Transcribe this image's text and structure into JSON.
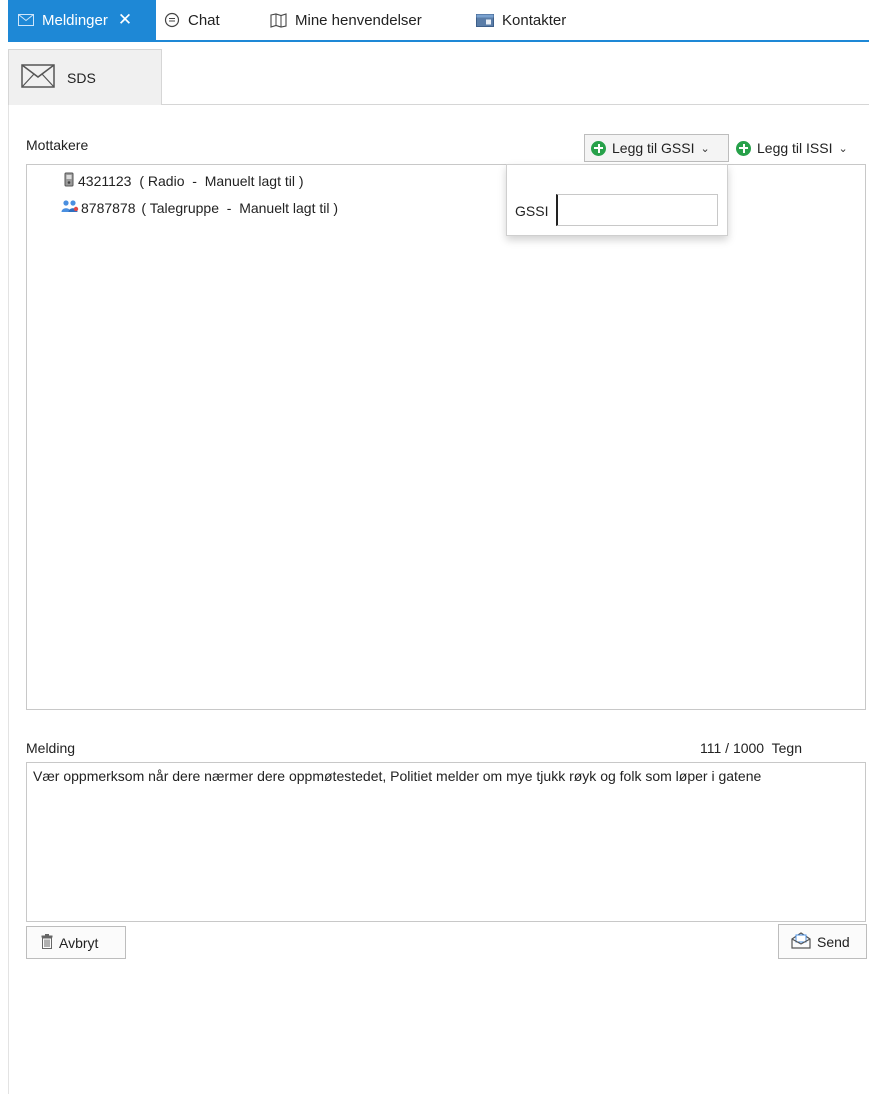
{
  "tabs": [
    {
      "label": "Meldinger",
      "icon": "envelope-icon",
      "active": true
    },
    {
      "label": "Chat",
      "icon": "chat-icon"
    },
    {
      "label": "Mine henvendelser",
      "icon": "map-icon"
    },
    {
      "label": "Kontakter",
      "icon": "contacts-card-icon"
    }
  ],
  "subtab": {
    "label": "SDS",
    "icon": "envelope-icon"
  },
  "recipients_section": {
    "label": "Mottakere",
    "add_gssi_label": "Legg til GSSI",
    "add_issi_label": "Legg til ISSI",
    "items": [
      {
        "number": "4321123",
        "details": " ( Radio  -  Manuelt lagt til )",
        "icon": "radio-icon"
      },
      {
        "number": "8787878",
        "details": " ( Talegruppe  -  Manuelt lagt til )",
        "icon": "talkgroup-icon"
      }
    ]
  },
  "gssi_popup": {
    "label": "GSSI",
    "value": ""
  },
  "message": {
    "label": "Melding",
    "counter": "111 / 1000  Tegn",
    "text": "Vær oppmerksom når dere nærmer dere oppmøtestedet, Politiet melder om mye tjukk røyk og folk som løper i gatene"
  },
  "actions": {
    "cancel_label": "Avbryt",
    "send_label": "Send"
  },
  "colors": {
    "accent": "#1e88d6",
    "add_green": "#27a14a"
  }
}
